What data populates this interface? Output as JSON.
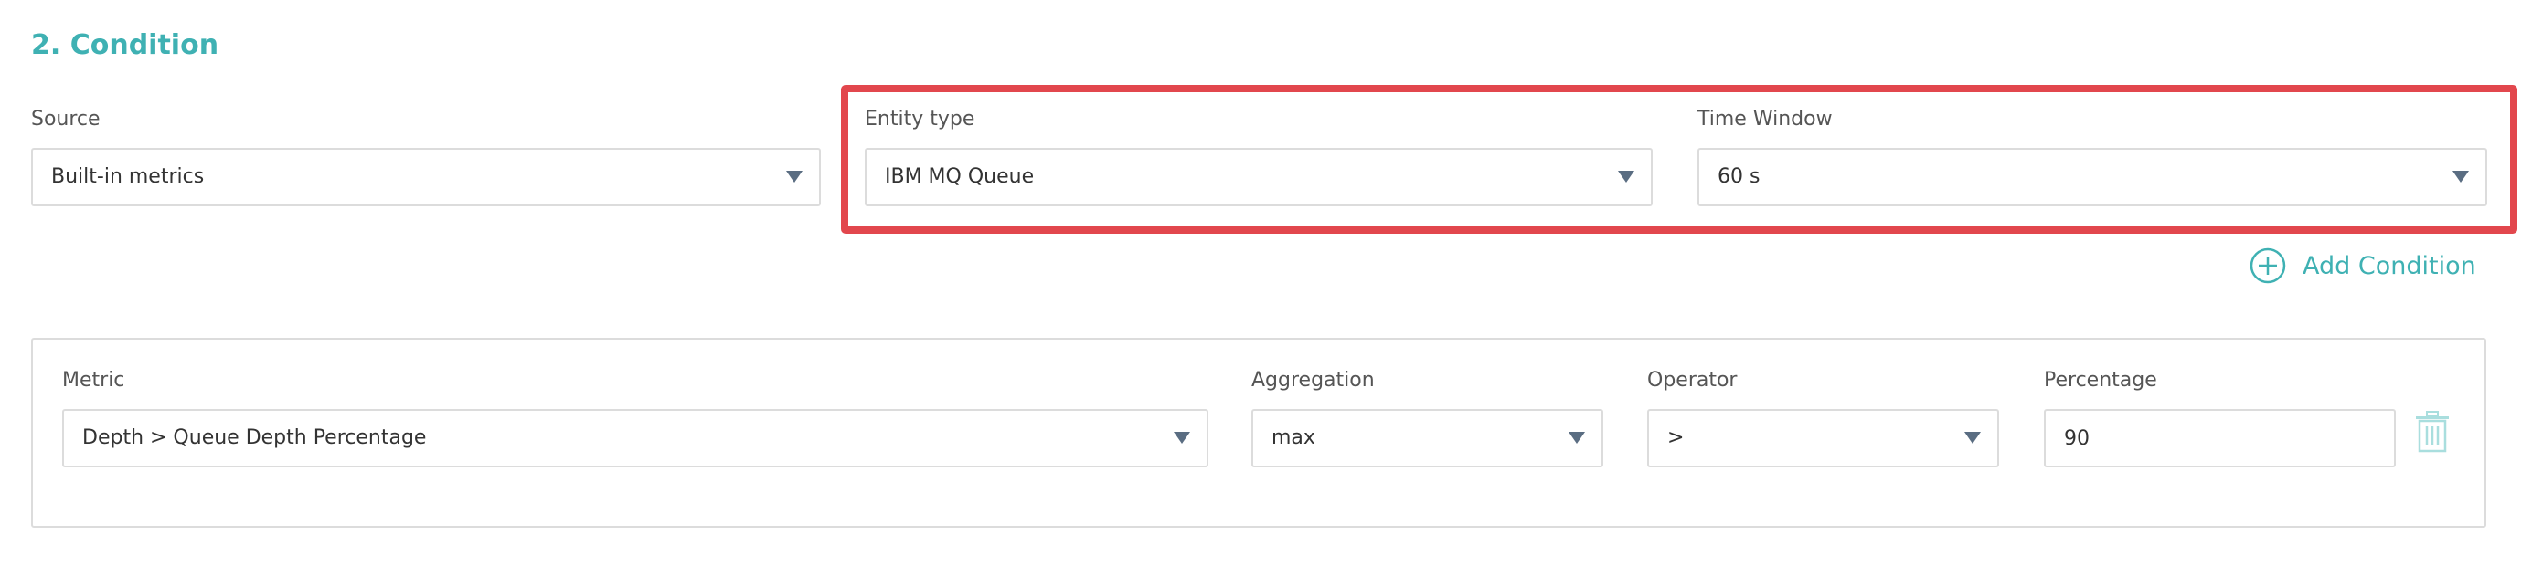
{
  "section": {
    "title": "2. Condition"
  },
  "source": {
    "label": "Source",
    "value": "Built-in metrics"
  },
  "entity_type": {
    "label": "Entity type",
    "value": "IBM MQ Queue"
  },
  "time_window": {
    "label": "Time Window",
    "value": "60 s"
  },
  "add_condition": {
    "label": "Add Condition",
    "icon": "plus-circle-icon"
  },
  "condition": {
    "metric": {
      "label": "Metric",
      "value": "Depth > Queue Depth Percentage"
    },
    "aggregation": {
      "label": "Aggregation",
      "value": "max"
    },
    "operator": {
      "label": "Operator",
      "value": ">"
    },
    "percentage": {
      "label": "Percentage",
      "value": "90"
    },
    "delete_icon": "trash-icon"
  },
  "colors": {
    "accent": "#3fb1b3",
    "highlight": "#e2474d",
    "border": "#dcdcdc",
    "caret": "#5a6d82",
    "trash": "#a9dede"
  }
}
